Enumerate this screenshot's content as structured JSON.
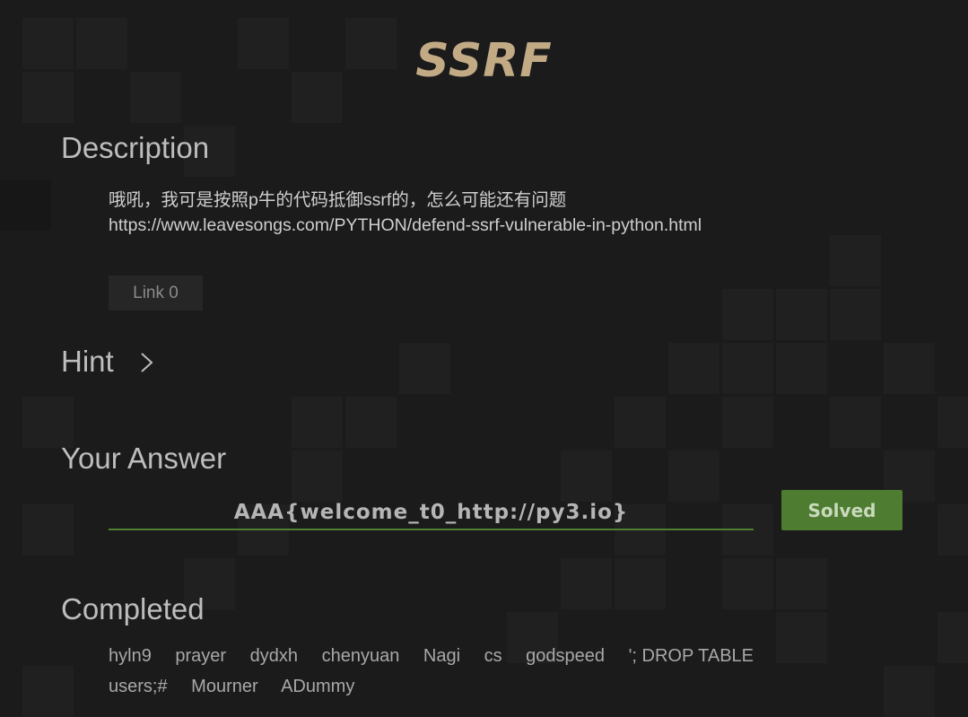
{
  "challenge": {
    "title": "SSRF"
  },
  "description": {
    "heading": "Description",
    "lines": [
      "哦吼，我可是按照p牛的代码抵御ssrf的，怎么可能还有问题",
      "https://www.leavesongs.com/PYTHON/defend-ssrf-vulnerable-in-python.html"
    ],
    "link_label": "Link 0"
  },
  "hint": {
    "heading": "Hint",
    "icon": "chevron-right-icon"
  },
  "answer": {
    "heading": "Your Answer",
    "value": "AAA{welcome_t0_http://py3.io}",
    "button_label": "Solved",
    "accent_color": "#4e7c30"
  },
  "completed": {
    "heading": "Completed",
    "users": [
      "hyln9",
      "prayer",
      "dydxh",
      "chenyuan",
      "Nagi",
      "cs",
      "godspeed",
      "'; DROP TABLE users;#",
      "Mourner",
      "ADummy"
    ]
  },
  "colors": {
    "title": "#c2aa85",
    "background": "#1b1b1b"
  }
}
